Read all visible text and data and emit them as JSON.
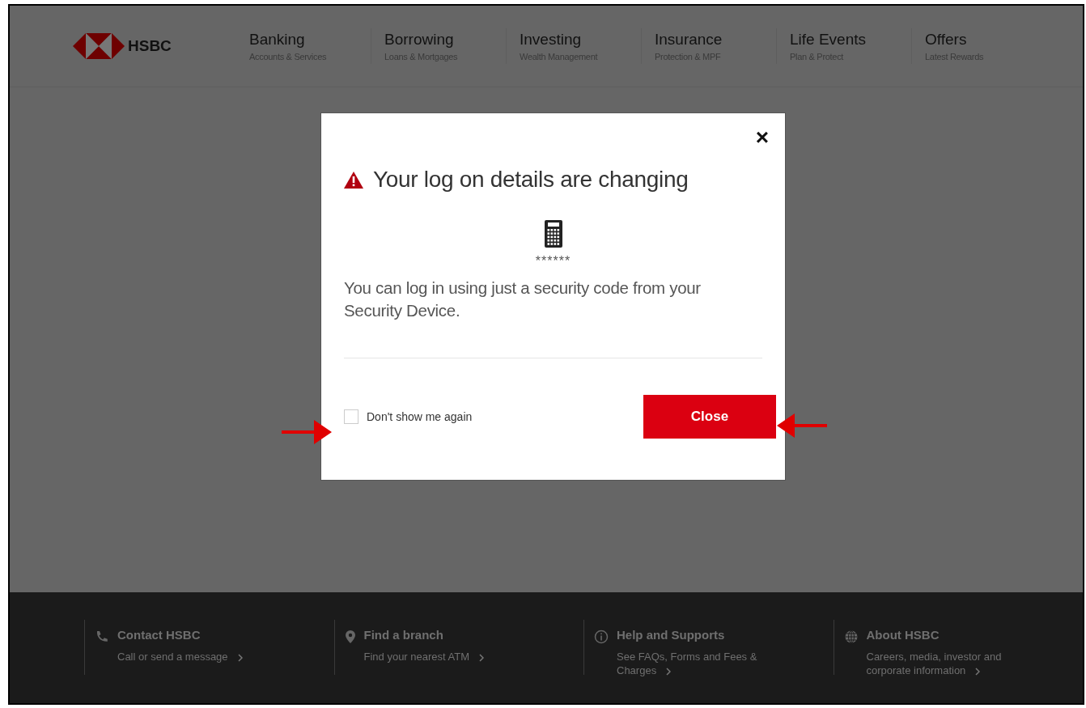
{
  "header": {
    "logo_text": "HSBC",
    "nav": [
      {
        "label": "Banking",
        "sublabel": "Accounts & Services"
      },
      {
        "label": "Borrowing",
        "sublabel": "Loans & Mortgages"
      },
      {
        "label": "Investing",
        "sublabel": "Wealth Management"
      },
      {
        "label": "Insurance",
        "sublabel": "Protection & MPF"
      },
      {
        "label": "Life Events",
        "sublabel": "Plan & Protect"
      },
      {
        "label": "Offers",
        "sublabel": "Latest Rewards"
      }
    ]
  },
  "dialog": {
    "close_icon": "×",
    "title": "Your log on details are changing",
    "code_mask": "******",
    "message": "You can log in using just a security code from your Security Device.",
    "checkbox": {
      "label": "Don't show me again",
      "checked": false
    },
    "button": "Close"
  },
  "footer": [
    {
      "kind": "phone",
      "title": "Contact HSBC",
      "link": "Call or send a message"
    },
    {
      "kind": "pin",
      "title": "Find a branch",
      "link": "Find your nearest ATM"
    },
    {
      "kind": "info",
      "title": "Help and Supports",
      "link": "See FAQs, Forms and Fees & Charges"
    },
    {
      "kind": "globe",
      "title": "About HSBC",
      "link": "Careers, media, investor and corporate information"
    }
  ]
}
